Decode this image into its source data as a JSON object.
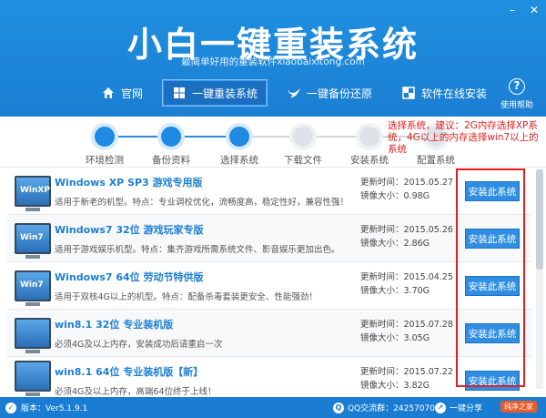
{
  "window": {
    "minimize": "–",
    "close": "✕"
  },
  "header": {
    "title": "小白一键重装系统",
    "slogan": "最简单好用的重装软件xiaobaixitong.com"
  },
  "nav": {
    "items": [
      {
        "label": "官网"
      },
      {
        "label": "一键重装系统"
      },
      {
        "label": "一键备份还原"
      },
      {
        "label": "软件在线安装"
      }
    ],
    "help_label": "使用帮助",
    "help_glyph": "?"
  },
  "steps": {
    "items": [
      {
        "label": "环境检测",
        "done": true
      },
      {
        "label": "备份资料",
        "done": true
      },
      {
        "label": "选择系统",
        "done": true
      },
      {
        "label": "下载文件",
        "done": false
      },
      {
        "label": "安装系统",
        "done": false
      },
      {
        "label": "配置系统",
        "done": false
      }
    ],
    "tip": "选择系统，建议：2G内存选择XP系统，4G以上的内存选择win7以上的系统"
  },
  "systems": {
    "update_prefix": "更新时间：",
    "size_prefix": "镜像大小：",
    "install_label": "安装此系统",
    "items": [
      {
        "icon_text": "WinXP",
        "title": "Windows XP SP3 游戏专用版",
        "desc": "适用于新老的机型。特点：专业调校优化，流畅度高，稳定性好，兼容性强！",
        "updated": "2015.05.27",
        "size": "0.98G"
      },
      {
        "icon_text": "Win7",
        "title": "Windows7 32位 游戏玩家专版",
        "desc": "适用于游戏娱乐机型。特点：集齐游戏所需系统文件、影音娱乐更加出色。",
        "updated": "2015.05.26",
        "size": "2.86G"
      },
      {
        "icon_text": "Win7",
        "title": "Windows7 64位 劳动节特供版",
        "desc": "适用于双核4G以上的机型。特点：配备杀毒套装更安全、性能强劲！",
        "updated": "2015.04.25",
        "size": "3.70G"
      },
      {
        "icon_text": "",
        "title": "win8.1 32位 专业装机版",
        "desc": "必须4G及以上内存，安装成功后请重启一次",
        "updated": "2015.07.28",
        "size": "3.05G"
      },
      {
        "icon_text": "",
        "title": "win8.1 64位 专业装机版【新】",
        "desc": "必须4G及以上内存，高端64位终于上线！",
        "updated": "2015.07.22",
        "size": "3.82G"
      }
    ]
  },
  "status": {
    "version": "版本：Ver5.1.9.1",
    "qq": "QQ交流群：242570703",
    "share": "一键分享",
    "logo": "纯净之家"
  },
  "colors": {
    "header_blue": "#1b7fd2",
    "tip_red": "#e02020",
    "title_blue": "#1e7fd3"
  }
}
